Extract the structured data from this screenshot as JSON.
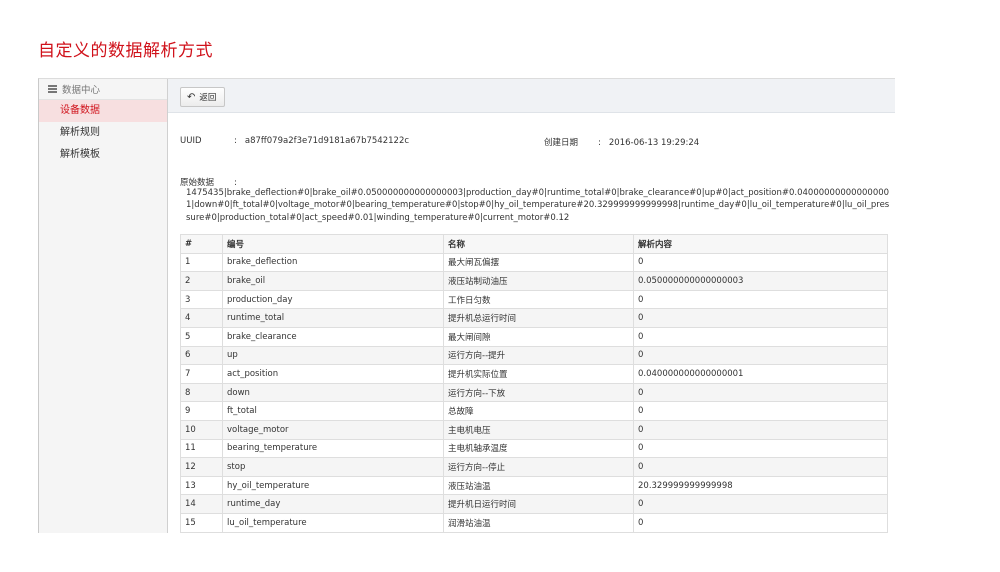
{
  "page_title": "自定义的数据解析方式",
  "sidebar": {
    "header": "数据中心",
    "items": [
      {
        "label": "设备数据",
        "active": true
      },
      {
        "label": "解析规则",
        "active": false
      },
      {
        "label": "解析模板",
        "active": false
      }
    ]
  },
  "toolbar": {
    "back_label": "返回"
  },
  "details": {
    "uuid_label": "UUID",
    "uuid_value": "a87ff079a2f3e71d9181a67b7542122c",
    "created_label": "创建日期",
    "created_value": "2016-06-13 19:29:24",
    "raw_label": "原始数据",
    "raw_value": "1475435|brake_deflection#0|brake_oil#0.050000000000000003|production_day#0|runtime_total#0|brake_clearance#0|up#0|act_position#0.040000000000000001|down#0|ft_total#0|voltage_motor#0|bearing_temperature#0|stop#0|hy_oil_temperature#20.329999999999998|runtime_day#0|lu_oil_temperature#0|lu_oil_pressure#0|production_total#0|act_speed#0.01|winding_temperature#0|current_motor#0.12"
  },
  "table": {
    "columns": [
      "#",
      "编号",
      "名称",
      "解析内容"
    ],
    "rows": [
      [
        "1",
        "brake_deflection",
        "最大闸瓦偏摆",
        "0"
      ],
      [
        "2",
        "brake_oil",
        "液压站制动油压",
        "0.050000000000000003"
      ],
      [
        "3",
        "production_day",
        "工作日匀数",
        "0"
      ],
      [
        "4",
        "runtime_total",
        "提升机总运行时间",
        "0"
      ],
      [
        "5",
        "brake_clearance",
        "最大闸间隙",
        "0"
      ],
      [
        "6",
        "up",
        "运行方向--提升",
        "0"
      ],
      [
        "7",
        "act_position",
        "提升机实际位置",
        "0.040000000000000001"
      ],
      [
        "8",
        "down",
        "运行方向--下放",
        "0"
      ],
      [
        "9",
        "ft_total",
        "总故障",
        "0"
      ],
      [
        "10",
        "voltage_motor",
        "主电机电压",
        "0"
      ],
      [
        "11",
        "bearing_temperature",
        "主电机轴承温度",
        "0"
      ],
      [
        "12",
        "stop",
        "运行方向--停止",
        "0"
      ],
      [
        "13",
        "hy_oil_temperature",
        "液压站油温",
        "20.329999999999998"
      ],
      [
        "14",
        "runtime_day",
        "提升机日运行时间",
        "0"
      ],
      [
        "15",
        "lu_oil_temperature",
        "润滑站油温",
        "0"
      ]
    ]
  },
  "colors": {
    "accent": "#d0121b",
    "active_bg": "#f7dfe0",
    "sidebar_bg": "#f5f5f5"
  },
  "icons": {
    "sidebar_header": "list-icon",
    "back": "undo-icon"
  }
}
